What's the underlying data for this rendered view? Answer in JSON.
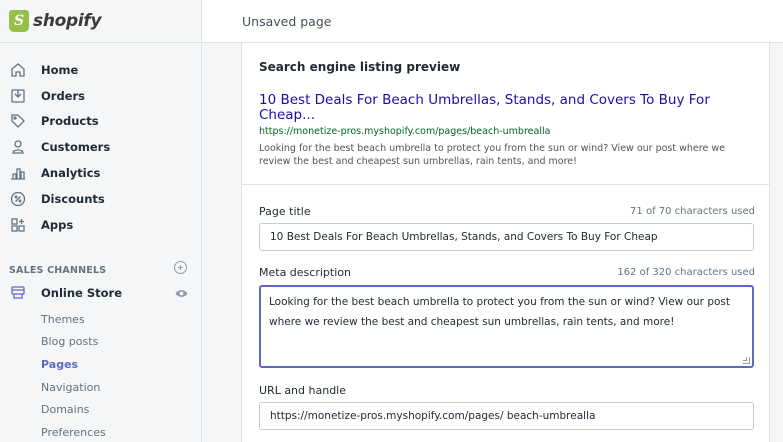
{
  "brand": {
    "name": "shopify",
    "logo_icon": "shopify-bag-icon"
  },
  "topbar": {
    "title": "Unsaved page"
  },
  "sidebar": {
    "items": [
      {
        "label": "Home",
        "icon": "home-icon"
      },
      {
        "label": "Orders",
        "icon": "orders-icon"
      },
      {
        "label": "Products",
        "icon": "tag-icon"
      },
      {
        "label": "Customers",
        "icon": "person-icon"
      },
      {
        "label": "Analytics",
        "icon": "bar-chart-icon"
      },
      {
        "label": "Discounts",
        "icon": "discount-icon"
      },
      {
        "label": "Apps",
        "icon": "apps-icon"
      }
    ],
    "sales_channels": {
      "title": "SALES CHANNELS",
      "add_icon": "plus-circle-icon",
      "online_store": {
        "label": "Online Store",
        "icon": "store-icon",
        "view_icon": "eye-icon"
      },
      "sub_items": [
        {
          "label": "Themes",
          "active": false
        },
        {
          "label": "Blog posts",
          "active": false
        },
        {
          "label": "Pages",
          "active": true
        },
        {
          "label": "Navigation",
          "active": false
        },
        {
          "label": "Domains",
          "active": false
        },
        {
          "label": "Preferences",
          "active": false
        }
      ]
    }
  },
  "seo": {
    "heading": "Search engine listing preview",
    "preview_title": "10 Best Deals For Beach Umbrellas, Stands, and Covers To Buy For Cheap...",
    "preview_url": "https://monetize-pros.myshopify.com/pages/beach-umbrealla",
    "preview_description": "Looking for the best beach umbrella to protect you from the sun or wind? View our post where we review the best and cheapest sun umbrellas, rain tents, and more!",
    "page_title": {
      "label": "Page title",
      "count": "71 of 70 characters used",
      "value": "10 Best Deals For Beach Umbrellas, Stands, and Covers To Buy For Cheap"
    },
    "meta_description": {
      "label": "Meta description",
      "count": "162 of 320 characters used",
      "value": "Looking for the best beach umbrella to protect you from the sun or wind? View our post where we review the best and cheapest sun umbrellas, rain tents, and more!"
    },
    "url_handle": {
      "label": "URL and handle",
      "value": "https://monetize-pros.myshopify.com/pages/ beach-umbrealla"
    }
  },
  "colors": {
    "accent": "#5c6ac4",
    "link_blue": "#1a0dab",
    "url_green": "#006621",
    "brand_green": "#95bf47"
  }
}
